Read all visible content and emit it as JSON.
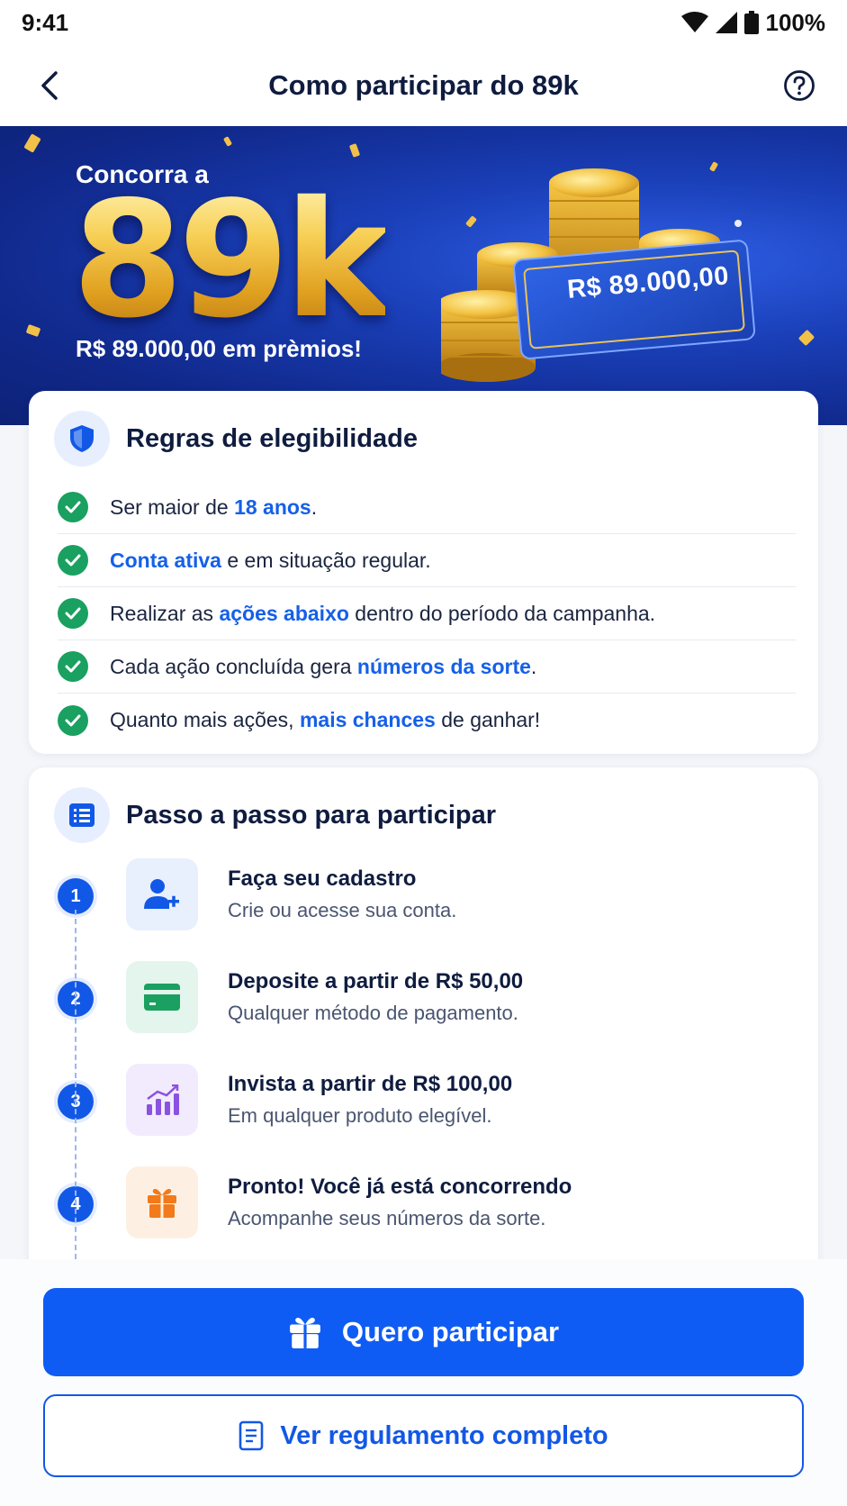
{
  "status_bar": {
    "time": "9:41",
    "battery": "100%"
  },
  "header": {
    "title": "Como participar do 89k",
    "back_icon": "chevron-left-icon",
    "help_icon": "help-circle-icon"
  },
  "hero": {
    "kicker": "Concorra a",
    "big": "89k",
    "subtitle": "R$ 89.000,00 em prèmios!",
    "ticket_value": "R$ 89.000,00"
  },
  "rules": {
    "title": "Regras de elegibilidade",
    "icon": "shield-icon",
    "items": [
      {
        "before": "Ser maior de ",
        "highlight": "18 anos",
        "after": "."
      },
      {
        "before": "",
        "highlight": "Conta ativa",
        "after": " e em situação regular."
      },
      {
        "before": "Realizar as ",
        "highlight": "ações abaixo",
        "after": " dentro do período da campanha."
      },
      {
        "before": "Cada ação concluída gera ",
        "highlight": "números da sorte",
        "after": "."
      },
      {
        "before": "Quanto mais ações, ",
        "highlight": "mais chances",
        "after": " de ganhar!"
      }
    ]
  },
  "steps": {
    "title": "Passo a passo para participar",
    "icon": "list-icon",
    "items": [
      {
        "number": "1",
        "title": "Faça seu cadastro",
        "desc": "Crie ou acesse sua conta.",
        "icon": "user-plus-icon"
      },
      {
        "number": "2",
        "title": "Deposite a partir de R$ 50,00",
        "desc": "Qualquer método de pagamento.",
        "icon": "card-icon"
      },
      {
        "number": "3",
        "title": "Invista a partir de R$ 100,00",
        "desc": "Em qualquer produto elegível.",
        "icon": "chart-icon"
      },
      {
        "number": "4",
        "title": "Pronto! Você já está concorrendo",
        "desc": "Acompanhe seus números da sorte.",
        "icon": "gift-icon"
      }
    ]
  },
  "actions": {
    "primary_label": "Quero participar",
    "secondary_label": "Ver regulamento completo"
  },
  "colors": {
    "primary": "#0f5cf5",
    "success": "#1aa060",
    "highlight": "#1560e8",
    "hero_bg": "#1a3fb8"
  }
}
